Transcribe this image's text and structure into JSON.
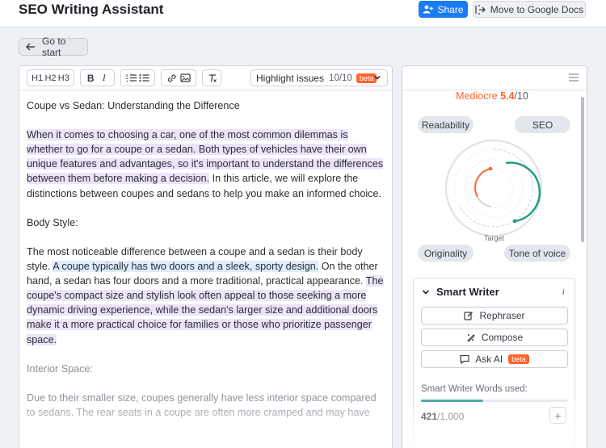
{
  "app": {
    "title": "SEO Writing Assistant"
  },
  "header": {
    "share_label": "Share",
    "move_label": "Move to Google Docs"
  },
  "nav": {
    "back_label": "Go to start"
  },
  "toolbar": {
    "h1": "H1",
    "h2": "H2",
    "h3": "H3",
    "bold": "B",
    "italic": "I",
    "highlight_label": "Highlight issues",
    "highlight_count": "10/10",
    "beta": "beta"
  },
  "document": {
    "title": "Coupe vs Sedan: Understanding the Difference",
    "p1_hl": "When it comes to choosing a car, one of the most common dilemmas is whether to go for a coupe or a sedan. Both types of vehicles have their own unique features and advantages, so it's important to understand the differences between them before making a decision.",
    "p1_rest": " In this article, we will explore the distinctions between coupes and sedans to help you make an informed choice.",
    "h_body": "Body Style:",
    "p2_a": "The most noticeable difference between a coupe and a sedan is their body style. ",
    "p2_hl_blue": "A coupe typically has two doors and a sleek, sporty design.",
    "p2_b": " On the other hand, a sedan has four doors and a more traditional, practical appearance. ",
    "p2_hl_purple": "The coupe's compact size and stylish look often appeal to those seeking a more dynamic driving experience, while the sedan's larger size and additional doors make it a more practical choice for families or those who prioritize passenger space.",
    "h_interior": "Interior Space:",
    "p3": "Due to their smaller size, coupes generally have less interior space compared to sedans. The rear seats in a coupe are often more cramped and may have"
  },
  "score": {
    "level": "Mediocre",
    "value": "5.4",
    "max": "/10",
    "value_fraction": 0.54
  },
  "metrics": {
    "readability": "Readability",
    "seo": "SEO",
    "originality": "Originality",
    "tone": "Tone of voice",
    "target_label": "Target"
  },
  "smart_writer": {
    "title": "Smart Writer",
    "info": "i",
    "rephraser": "Rephraser",
    "compose": "Compose",
    "ask_ai": "Ask AI",
    "beta": "beta",
    "words_used_label": "Smart Writer Words used:",
    "words_used": "421",
    "words_total": "/1,000",
    "words_used_fraction": 0.421,
    "plus": "+"
  },
  "colors": {
    "accent": "#1a7cf5",
    "orange": "#ff642d",
    "teal": "#1f9f82",
    "highlight_purple": "#ece4fb",
    "highlight_blue": "#deecfb"
  }
}
